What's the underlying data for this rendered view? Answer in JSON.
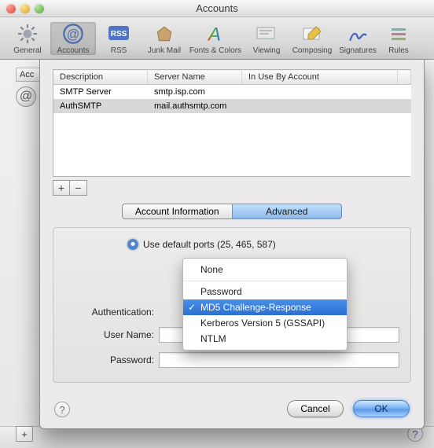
{
  "window": {
    "title": "Accounts"
  },
  "toolbar": {
    "items": [
      {
        "label": "General"
      },
      {
        "label": "Accounts"
      },
      {
        "label": "RSS"
      },
      {
        "label": "Junk Mail"
      },
      {
        "label": "Fonts & Colors"
      },
      {
        "label": "Viewing"
      },
      {
        "label": "Composing"
      },
      {
        "label": "Signatures"
      },
      {
        "label": "Rules"
      }
    ]
  },
  "accounts_stub": {
    "header": "Acc"
  },
  "server_table": {
    "headers": {
      "description": "Description",
      "server": "Server Name",
      "inuse": "In Use By Account"
    },
    "rows": [
      {
        "description": "SMTP Server",
        "server": "smtp.isp.com",
        "inuse": ""
      },
      {
        "description": "AuthSMTP",
        "server": "mail.authsmtp.com",
        "inuse": ""
      }
    ],
    "selected_index": 1,
    "buttons": {
      "add": "+",
      "remove": "−"
    }
  },
  "tabs": {
    "info": "Account Information",
    "advanced": "Advanced",
    "active": "advanced"
  },
  "form": {
    "ports_label": "Use default ports (25, 465, 587)",
    "authentication_label": "Authentication:",
    "username_label": "User Name:",
    "password_label": "Password:",
    "username_value": "",
    "password_value": ""
  },
  "auth_dropdown": {
    "options": [
      {
        "label": "None"
      },
      {
        "label": "Password"
      },
      {
        "label": "MD5 Challenge-Response"
      },
      {
        "label": "Kerberos Version 5 (GSSAPI)"
      },
      {
        "label": "NTLM"
      }
    ],
    "highlighted_index": 2
  },
  "buttons": {
    "cancel": "Cancel",
    "ok": "OK",
    "help": "?"
  }
}
